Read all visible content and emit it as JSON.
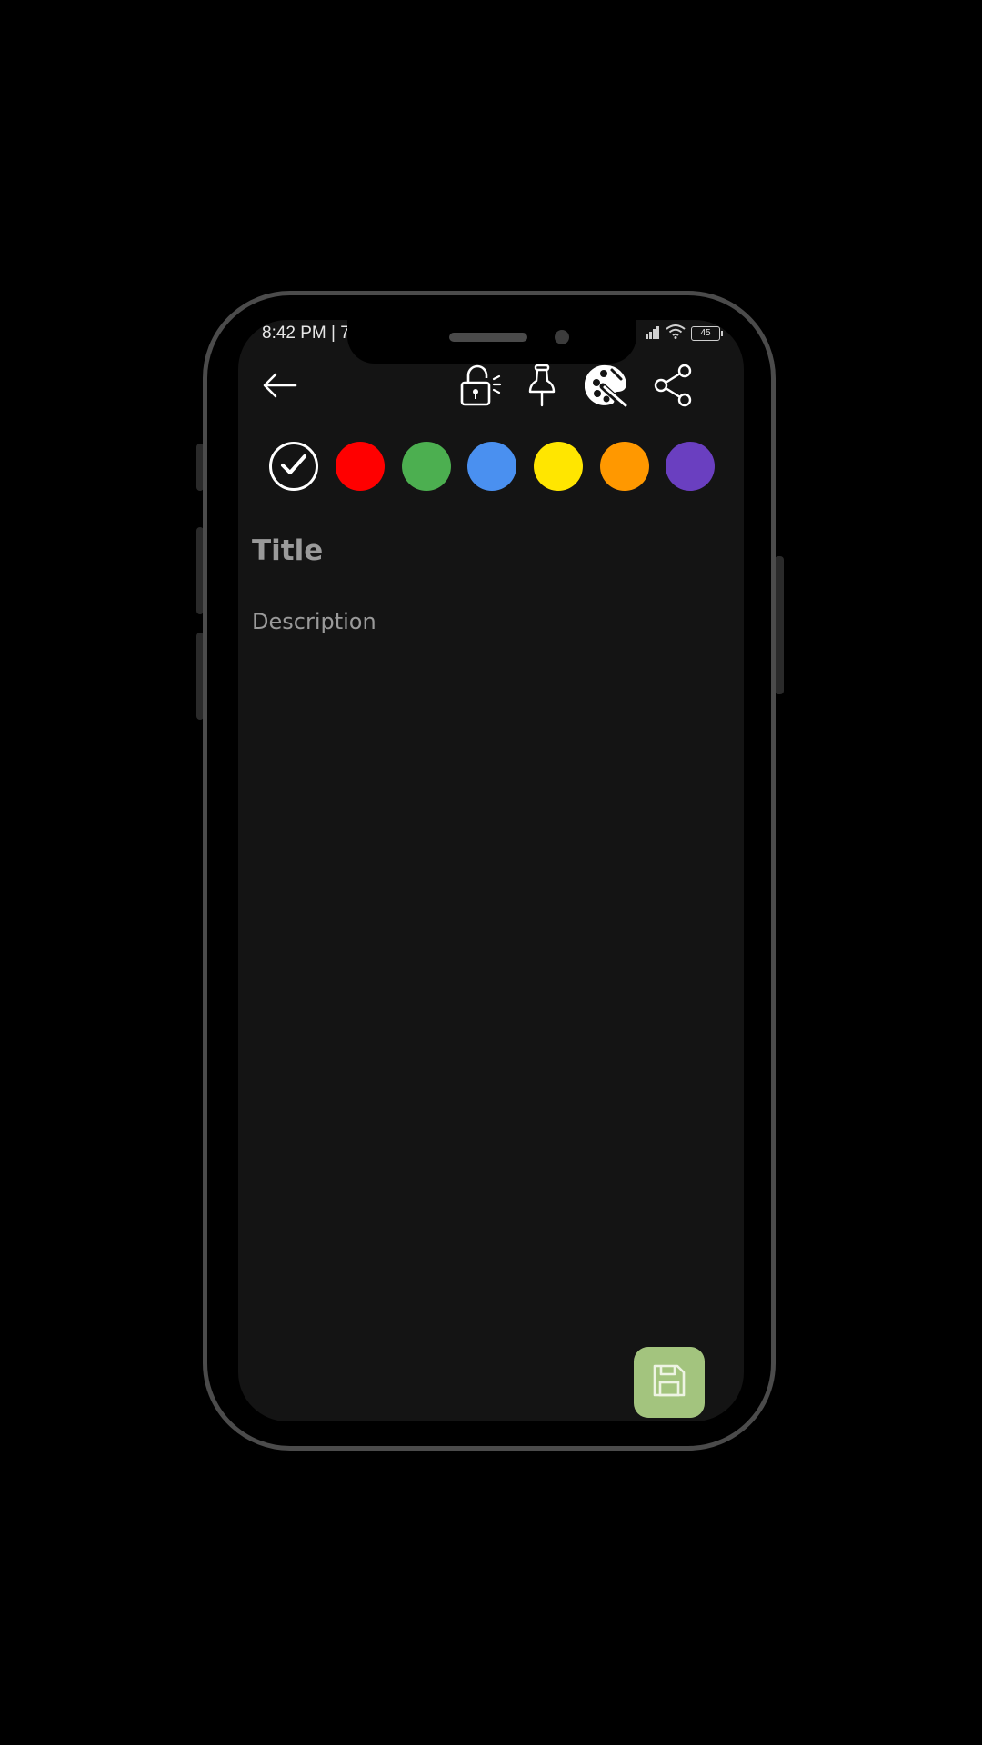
{
  "status_bar": {
    "time": "8:42 PM | 7",
    "battery_level": "45"
  },
  "toolbar": {
    "back_icon": "arrow-left-icon",
    "lock_icon": "unlock-icon",
    "pin_icon": "pushpin-icon",
    "palette_icon": "palette-icon",
    "share_icon": "share-icon"
  },
  "color_options": [
    {
      "name": "default",
      "color": "#141414",
      "selected": true
    },
    {
      "name": "red",
      "color": "#ff0000",
      "selected": false
    },
    {
      "name": "green",
      "color": "#4caf50",
      "selected": false
    },
    {
      "name": "blue",
      "color": "#4a90f0",
      "selected": false
    },
    {
      "name": "yellow",
      "color": "#ffe600",
      "selected": false
    },
    {
      "name": "orange",
      "color": "#ff9800",
      "selected": false
    },
    {
      "name": "purple",
      "color": "#6a3fc0",
      "selected": false
    }
  ],
  "editor": {
    "title_placeholder": "Title",
    "description_placeholder": "Description"
  },
  "fab": {
    "icon": "save-icon",
    "color": "#a3c47e"
  }
}
